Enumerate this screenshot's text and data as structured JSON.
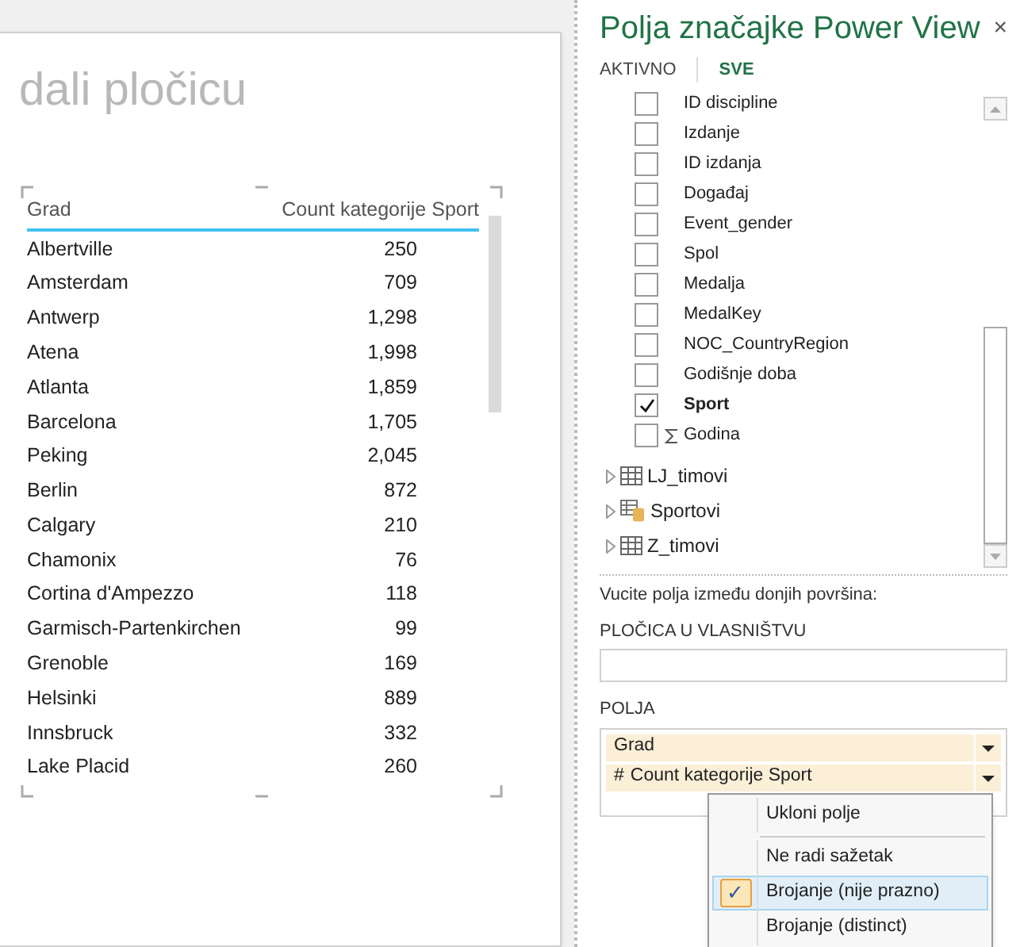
{
  "canvas": {
    "title": "dali pločicu"
  },
  "table": {
    "columns": [
      "Grad",
      "Count kategorije Sport"
    ],
    "rows": [
      [
        "Albertville",
        "250"
      ],
      [
        "Amsterdam",
        "709"
      ],
      [
        "Antwerp",
        "1,298"
      ],
      [
        "Atena",
        "1,998"
      ],
      [
        "Atlanta",
        "1,859"
      ],
      [
        "Barcelona",
        "1,705"
      ],
      [
        "Peking",
        "2,045"
      ],
      [
        "Berlin",
        "872"
      ],
      [
        "Calgary",
        "210"
      ],
      [
        "Chamonix",
        "76"
      ],
      [
        "Cortina d'Ampezzo",
        "118"
      ],
      [
        "Garmisch-Partenkirchen",
        "99"
      ],
      [
        "Grenoble",
        "169"
      ],
      [
        "Helsinki",
        "889"
      ],
      [
        "Innsbruck",
        "332"
      ],
      [
        "Lake Placid",
        "260"
      ]
    ]
  },
  "panel": {
    "title": "Polja značajke Power View",
    "close": "×",
    "tabs": [
      {
        "label": "AKTIVNO",
        "selected": false
      },
      {
        "label": "SVE",
        "selected": true
      }
    ],
    "fields": [
      {
        "name": "ID discipline",
        "checked": false,
        "kind": "field"
      },
      {
        "name": "Izdanje",
        "checked": false,
        "kind": "field"
      },
      {
        "name": "ID izdanja",
        "checked": false,
        "kind": "field"
      },
      {
        "name": "Događaj",
        "checked": false,
        "kind": "field"
      },
      {
        "name": "Event_gender",
        "checked": false,
        "kind": "field"
      },
      {
        "name": "Spol",
        "checked": false,
        "kind": "field"
      },
      {
        "name": "Medalja",
        "checked": false,
        "kind": "field"
      },
      {
        "name": "MedalKey",
        "checked": false,
        "kind": "field"
      },
      {
        "name": "NOC_CountryRegion",
        "checked": false,
        "kind": "field"
      },
      {
        "name": "Godišnje doba",
        "checked": false,
        "kind": "field"
      },
      {
        "name": "Sport",
        "checked": true,
        "kind": "field"
      },
      {
        "name": "Godina",
        "checked": false,
        "kind": "sum"
      }
    ],
    "tables": [
      {
        "name": "LJ_timovi",
        "kind": "table",
        "expanded": false
      },
      {
        "name": "Sportovi",
        "kind": "linked",
        "expanded": false
      },
      {
        "name": "Z_timovi",
        "kind": "table",
        "expanded": false
      }
    ],
    "hint": "Vucite polja između donjih površina:",
    "tile_by": {
      "label": "PLOČICA U VLASNIŠTVU"
    },
    "fields_well": {
      "label": "POLJA",
      "items": [
        {
          "label": "Grad"
        },
        {
          "label": "Count kategorije Sport",
          "prefix": "#"
        }
      ]
    },
    "menu": {
      "groups": [
        [
          {
            "label": "Ukloni polje",
            "selected": false
          }
        ],
        [
          {
            "label": "Ne radi sažetak",
            "selected": false
          },
          {
            "label": "Brojanje (nije prazno)",
            "selected": true
          },
          {
            "label": "Brojanje (distinct)",
            "selected": false
          }
        ]
      ],
      "check": "✓"
    }
  }
}
